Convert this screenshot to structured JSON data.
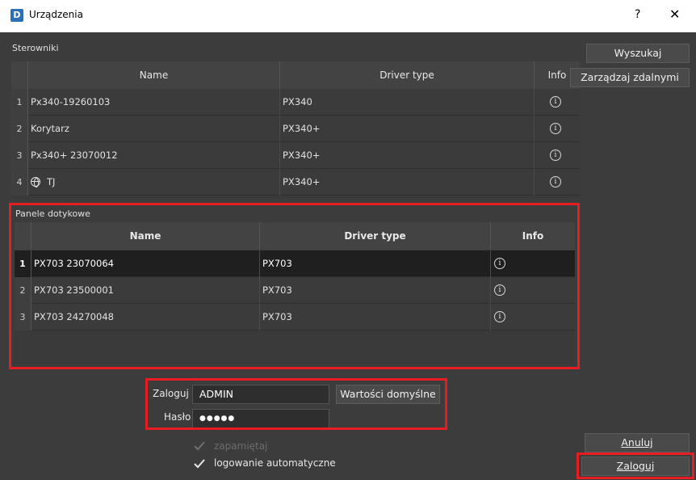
{
  "window": {
    "title": "Urządzenia",
    "help_label": "?",
    "close_label": "✕"
  },
  "controllers": {
    "group_label": "Sterowniki",
    "columns": [
      "Name",
      "Driver type",
      "Info"
    ],
    "rows": [
      {
        "num": "1",
        "name": "Px340-19260103",
        "driver": "PX340"
      },
      {
        "num": "2",
        "name": "Korytarz",
        "driver": "PX340+"
      },
      {
        "num": "3",
        "name": "Px340+ 23070012",
        "driver": "PX340+"
      },
      {
        "num": "4",
        "name": "TJ",
        "driver": "PX340+",
        "remote": true
      }
    ]
  },
  "panels": {
    "group_label": "Panele dotykowe",
    "columns": [
      "Name",
      "Driver type",
      "Info"
    ],
    "rows": [
      {
        "num": "1",
        "name": "PX703 23070064",
        "driver": "PX703",
        "selected": true
      },
      {
        "num": "2",
        "name": "PX703 23500001",
        "driver": "PX703"
      },
      {
        "num": "3",
        "name": "PX703 24270048",
        "driver": "PX703"
      }
    ]
  },
  "side_buttons": {
    "search": "Wyszukaj",
    "manage_remote": "Zarządzaj zdalnymi"
  },
  "login": {
    "user_label": "Zaloguj",
    "user_value": "ADMIN",
    "defaults_button": "Wartości domyślne",
    "password_label": "Hasło",
    "password_value": "●●●●●",
    "remember_label": "zapamiętaj",
    "remember_checked": true,
    "remember_disabled": true,
    "autologin_label": "logowanie automatyczne",
    "autologin_checked": true
  },
  "footer": {
    "cancel_label": "Anuluj",
    "login_label": "Zaloguj"
  },
  "colors": {
    "highlight": "#e81d24",
    "background": "#3c3c3c",
    "selected_row": "#1f1f1f"
  }
}
